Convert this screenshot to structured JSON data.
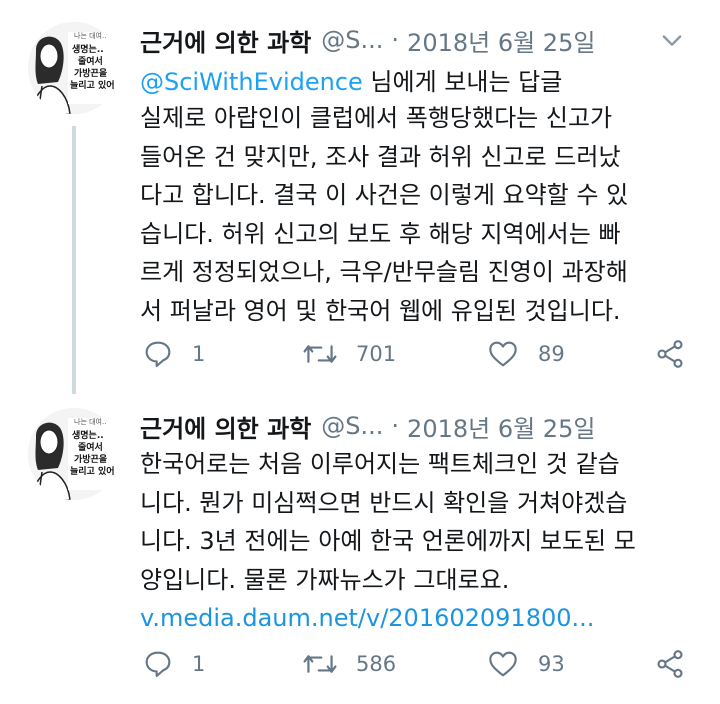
{
  "tweets": [
    {
      "author_name": "근거에 의한 과학",
      "handle": "@S...",
      "separator": "·",
      "date": "2018년 6월 25일",
      "reply_prefix": "@SciWithEvidence",
      "reply_suffix": " 님에게 보내는 답글",
      "body_lines": [
        "실제로 아랍인이 클럽에서 폭행당했다는 신고가",
        "들어온 건 맞지만, 조사 결과 허위 신고로 드러났",
        "다고 합니다. 결국 이 사건은 이렇게 요약할 수 있",
        "습니다. 허위 신고의 보도 후 해당 지역에서는 빠",
        "르게 정정되었으나, 극우/반무슬림 진영이 과장해",
        "서 퍼날라 영어 및 한국어 웹에 유입된 것입니다."
      ],
      "link": "",
      "replies": "1",
      "retweets": "701",
      "likes": "89",
      "avatar_sign_lines": [
        "나는 대여..",
        "생명는..",
        "줄여서",
        "가방끈을",
        "늘리고 있어"
      ]
    },
    {
      "author_name": "근거에 의한 과학",
      "handle": "@S...",
      "separator": "·",
      "date": "2018년 6월 25일",
      "reply_prefix": "",
      "reply_suffix": "",
      "body_lines": [
        "한국어로는 처음 이루어지는 팩트체크인 것 같습",
        "니다. 뭔가 미심쩍으면 반드시 확인을 거쳐야겠습",
        "니다. 3년 전에는 아예 한국 언론에까지 보도된 모",
        "양입니다. 물론 가짜뉴스가 그대로요."
      ],
      "link": "v.media.daum.net/v/201602091800...",
      "replies": "1",
      "retweets": "586",
      "likes": "93",
      "avatar_sign_lines": [
        "나는 대여..",
        "생명는..",
        "줄여서",
        "가방끈을",
        "늘리고 있어"
      ]
    }
  ],
  "colors": {
    "text": "#14171a",
    "secondary": "#657786",
    "accent": "#1da1f2",
    "link": "#1b95e0",
    "thread_line": "#cfd9de"
  },
  "icons": {
    "reply": "reply-icon",
    "retweet": "retweet-icon",
    "like": "heart-icon",
    "share": "share-icon",
    "menu": "chevron-down-icon"
  }
}
